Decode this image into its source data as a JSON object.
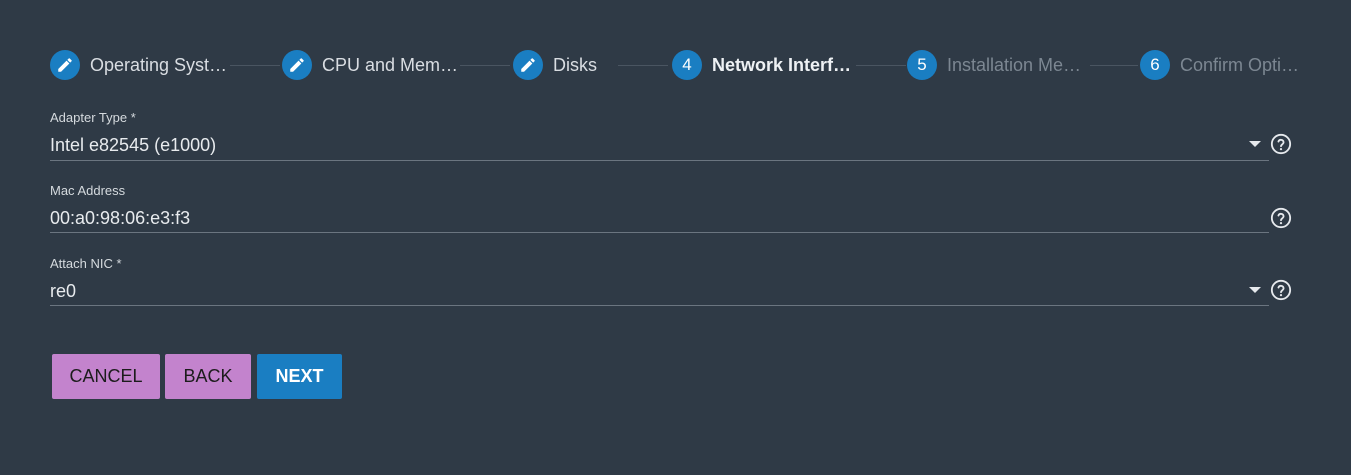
{
  "stepper": {
    "steps": [
      {
        "label": "Operating Syst…",
        "marker": "pencil-icon",
        "state": "done"
      },
      {
        "label": "CPU and Mem…",
        "marker": "pencil-icon",
        "state": "done"
      },
      {
        "label": "Disks",
        "marker": "pencil-icon",
        "state": "done"
      },
      {
        "label": "Network Interf…",
        "number": "4",
        "state": "active"
      },
      {
        "label": "Installation Me…",
        "number": "5",
        "state": "pending"
      },
      {
        "label": "Confirm Opti…",
        "number": "6",
        "state": "pending"
      }
    ]
  },
  "form": {
    "adapter_type": {
      "label": "Adapter Type *",
      "value": "Intel e82545 (e1000)"
    },
    "mac_address": {
      "label": "Mac Address",
      "value": "00:a0:98:06:e3:f3"
    },
    "attach_nic": {
      "label": "Attach NIC *",
      "value": "re0"
    }
  },
  "buttons": {
    "cancel": "CANCEL",
    "back": "BACK",
    "next": "NEXT"
  },
  "colors": {
    "background": "#2f3a46",
    "primary": "#1a7ec2",
    "secondary_button": "#c383cd"
  }
}
